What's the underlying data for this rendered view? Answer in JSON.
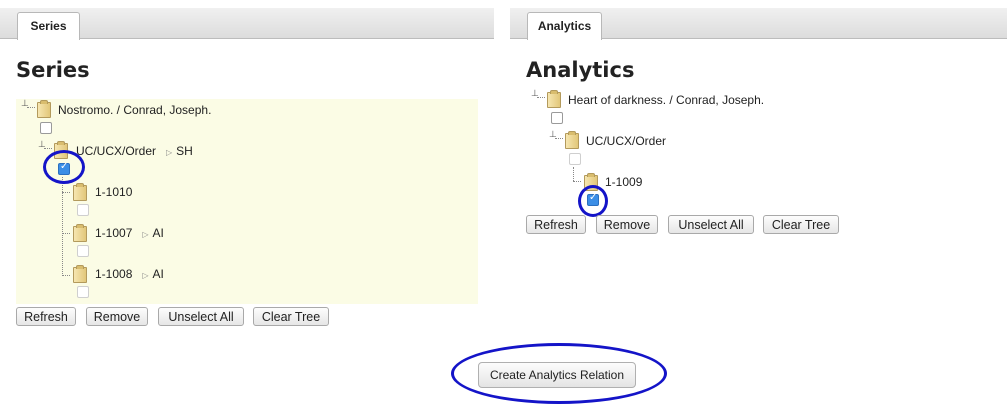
{
  "series": {
    "tab_label": "Series",
    "heading": "Series",
    "tree": {
      "root_label": "Nostromo. / Conrad, Joseph.",
      "order_label": "UC/UCX/Order",
      "order_tag": "SH",
      "items": [
        {
          "label": "1-1010",
          "tag": ""
        },
        {
          "label": "1-1007",
          "tag": "AI"
        },
        {
          "label": "1-1008",
          "tag": "AI"
        }
      ]
    },
    "buttons": {
      "refresh": "Refresh",
      "remove": "Remove",
      "unselect_all": "Unselect All",
      "clear_tree": "Clear Tree"
    }
  },
  "analytics": {
    "tab_label": "Analytics",
    "heading": "Analytics",
    "tree": {
      "root_label": "Heart of darkness. / Conrad, Joseph.",
      "order_label": "UC/UCX/Order",
      "items": [
        {
          "label": "1-1009"
        }
      ]
    },
    "buttons": {
      "refresh": "Refresh",
      "remove": "Remove",
      "unselect_all": "Unselect All",
      "clear_tree": "Clear Tree"
    }
  },
  "create_button_label": "Create Analytics Relation",
  "checked": {
    "series_order": true,
    "analytics_item_1009": true
  },
  "colors": {
    "highlight_ring": "#1414c8",
    "tree_background": "#fbfce5",
    "checkbox_checked": "#3b8ee6"
  }
}
